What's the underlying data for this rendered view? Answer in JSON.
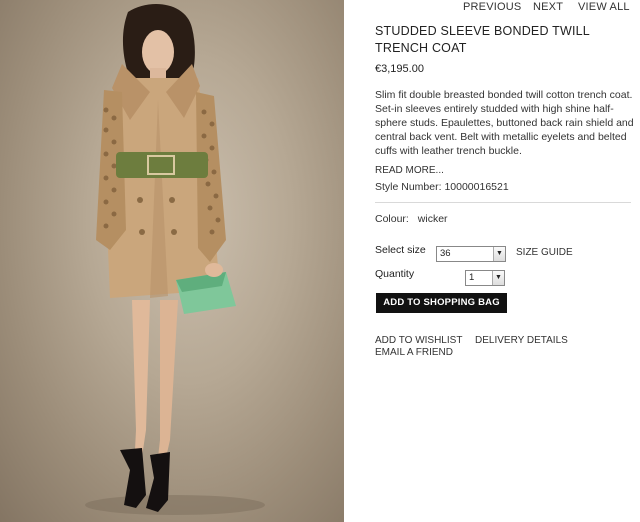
{
  "nav": {
    "previous": "PREVIOUS",
    "next": "NEXT",
    "view_all": "VIEW ALL"
  },
  "product": {
    "title": "STUDDED SLEEVE BONDED TWILL TRENCH COAT",
    "price": "€3,195.00",
    "description": "Slim fit double breasted bonded twill cotton trench coat. Set-in sleeves entirely studded with high shine half-sphere studs. Epaulettes, buttoned back rain shield and central back vent. Belt with metallic eyelets and belted cuffs with leather trench buckle.",
    "read_more": "READ MORE...",
    "style_number": "Style Number: 10000016521",
    "colour_label": "Colour:",
    "colour_value": "wicker"
  },
  "form": {
    "size_label": "Select size",
    "size_value": "36",
    "size_guide": "SIZE GUIDE",
    "quantity_label": "Quantity",
    "quantity_value": "1",
    "add_to_bag": "ADD TO SHOPPING BAG"
  },
  "links": {
    "wishlist": "ADD TO WISHLIST",
    "delivery": "DELIVERY DETAILS",
    "email_friend": "EMAIL A FRIEND"
  },
  "colors": {
    "button_bg": "#111111",
    "coat": "#c9a57c",
    "clutch": "#7fc79a"
  }
}
